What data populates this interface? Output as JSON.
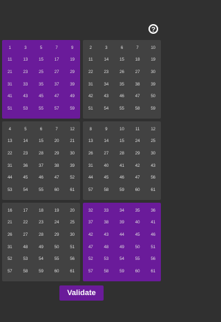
{
  "header": {
    "help_icon": "help-circle-icon",
    "help_glyph": "?"
  },
  "colors": {
    "background": "#303030",
    "card": "#424242",
    "selected_card": "#6a1b9a",
    "text": "#e0e0e0"
  },
  "cards": [
    {
      "selected": true,
      "numbers": [
        "1",
        "3",
        "5",
        "7",
        "9",
        "11",
        "13",
        "15",
        "17",
        "19",
        "21",
        "23",
        "25",
        "27",
        "29",
        "31",
        "33",
        "35",
        "37",
        "39",
        "41",
        "43",
        "45",
        "47",
        "49",
        "51",
        "53",
        "55",
        "57",
        "59"
      ]
    },
    {
      "selected": false,
      "numbers": [
        "2",
        "3",
        "6",
        "7",
        "10",
        "11",
        "14",
        "15",
        "18",
        "19",
        "22",
        "23",
        "26",
        "27",
        "30",
        "31",
        "34",
        "35",
        "38",
        "39",
        "42",
        "43",
        "46",
        "47",
        "50",
        "51",
        "54",
        "55",
        "58",
        "59"
      ]
    },
    {
      "selected": false,
      "numbers": [
        "4",
        "5",
        "6",
        "7",
        "12",
        "13",
        "14",
        "15",
        "20",
        "21",
        "22",
        "23",
        "28",
        "29",
        "30",
        "31",
        "36",
        "37",
        "38",
        "39",
        "44",
        "45",
        "46",
        "47",
        "52",
        "53",
        "54",
        "55",
        "60",
        "61"
      ]
    },
    {
      "selected": false,
      "numbers": [
        "8",
        "9",
        "10",
        "11",
        "12",
        "13",
        "14",
        "15",
        "24",
        "25",
        "26",
        "27",
        "28",
        "29",
        "30",
        "31",
        "40",
        "41",
        "42",
        "43",
        "44",
        "45",
        "46",
        "47",
        "56",
        "57",
        "58",
        "59",
        "60",
        "61"
      ]
    },
    {
      "selected": false,
      "numbers": [
        "16",
        "17",
        "18",
        "19",
        "20",
        "21",
        "22",
        "23",
        "24",
        "25",
        "26",
        "27",
        "28",
        "29",
        "30",
        "31",
        "48",
        "49",
        "50",
        "51",
        "52",
        "53",
        "54",
        "55",
        "56",
        "57",
        "58",
        "59",
        "60",
        "61"
      ]
    },
    {
      "selected": true,
      "numbers": [
        "32",
        "33",
        "34",
        "35",
        "36",
        "37",
        "38",
        "39",
        "40",
        "41",
        "42",
        "43",
        "44",
        "45",
        "46",
        "47",
        "48",
        "49",
        "50",
        "51",
        "52",
        "53",
        "54",
        "55",
        "56",
        "57",
        "58",
        "59",
        "60",
        "61"
      ]
    }
  ],
  "footer": {
    "validate_label": "Validate"
  }
}
